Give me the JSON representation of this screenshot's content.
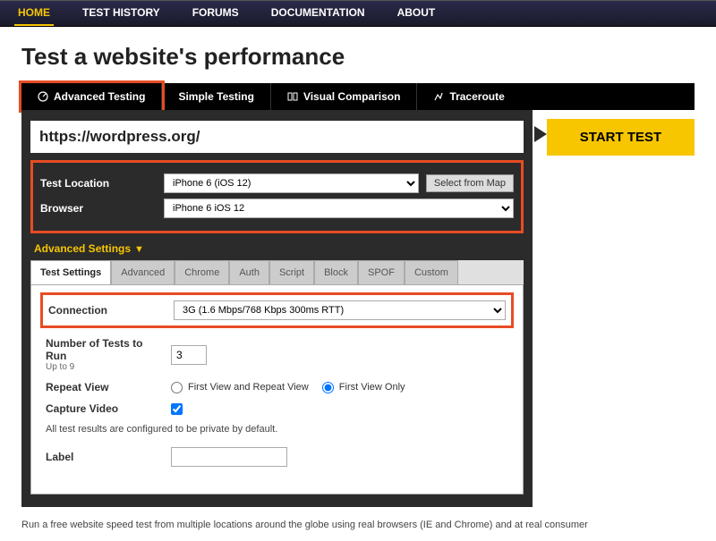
{
  "nav": {
    "home": "HOME",
    "history": "TEST HISTORY",
    "forums": "FORUMS",
    "docs": "DOCUMENTATION",
    "about": "ABOUT"
  },
  "title": "Test a website's performance",
  "tabs": {
    "advanced": "Advanced Testing",
    "simple": "Simple Testing",
    "visual": "Visual Comparison",
    "trace": "Traceroute"
  },
  "startLabel": "START TEST",
  "url": "https://wordpress.org/",
  "form": {
    "locationLabel": "Test Location",
    "locationValue": "iPhone 6 (iOS 12)",
    "mapBtn": "Select from Map",
    "browserLabel": "Browser",
    "browserValue": "iPhone 6 iOS 12"
  },
  "advHeader": "Advanced Settings",
  "subtabs": [
    "Test Settings",
    "Advanced",
    "Chrome",
    "Auth",
    "Script",
    "Block",
    "SPOF",
    "Custom"
  ],
  "settings": {
    "connectionLabel": "Connection",
    "connectionValue": "3G (1.6 Mbps/768 Kbps 300ms RTT)",
    "numTestsLabel": "Number of Tests to Run",
    "numTestsSub": "Up to 9",
    "numTestsValue": "3",
    "repeatLabel": "Repeat View",
    "repeatOpt1": "First View and Repeat View",
    "repeatOpt2": "First View Only",
    "captureLabel": "Capture Video",
    "privateNote": "All test results are configured to be private by default.",
    "labelLabel": "Label"
  },
  "footer": "Run a free website speed test from multiple locations around the globe using real browsers (IE and Chrome) and at real consumer"
}
